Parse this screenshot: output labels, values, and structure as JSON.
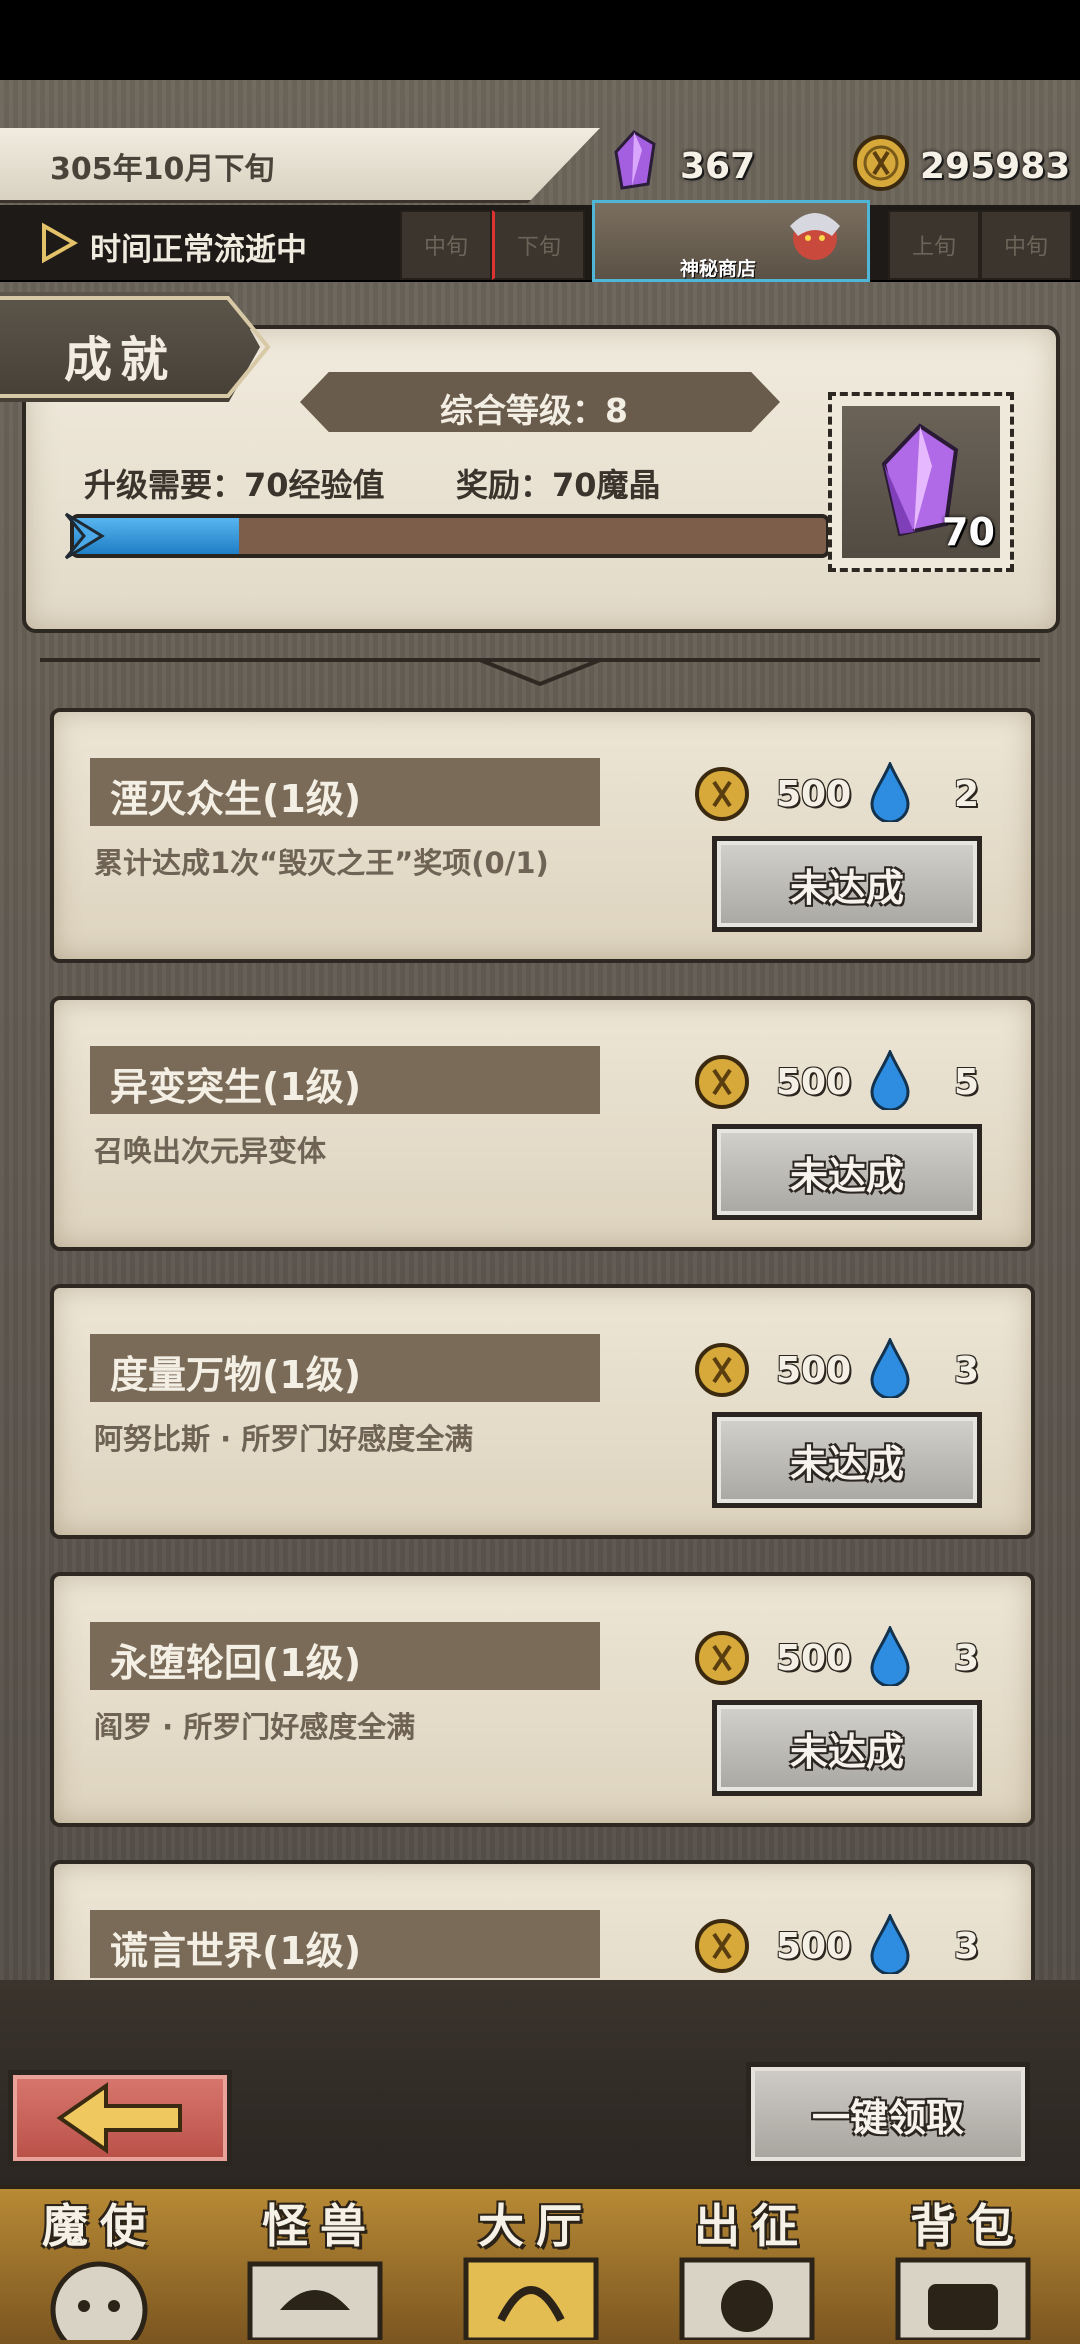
{
  "header": {
    "date": "305年10月下旬",
    "crystal_count": "367",
    "coin_count": "295983",
    "time_status": "时间正常流逝中",
    "slots_left": [
      "中旬",
      "下旬"
    ],
    "shop_label": "神秘商店",
    "slots_right": [
      "上旬",
      "中旬"
    ]
  },
  "achievement": {
    "tab_title": "成就",
    "level_label": "综合等级：8",
    "upgrade_requirement": "升级需要：70经验值",
    "reward_label": "奖励：70魔晶",
    "progress_fraction": 0.22,
    "reward_stamp_count": "70"
  },
  "items": [
    {
      "name": "湮灭众生(1级)",
      "desc": "累计达成1次“毁灭之王”奖项(0/1)",
      "coin": "500",
      "drop": "2",
      "status": "未达成"
    },
    {
      "name": "异变突生(1级)",
      "desc": "召唤出次元异变体",
      "coin": "500",
      "drop": "5",
      "status": "未达成"
    },
    {
      "name": "度量万物(1级)",
      "desc": "阿努比斯 · 所罗门好感度全满",
      "coin": "500",
      "drop": "3",
      "status": "未达成"
    },
    {
      "name": "永堕轮回(1级)",
      "desc": "阎罗 · 所罗门好感度全满",
      "coin": "500",
      "drop": "3",
      "status": "未达成"
    },
    {
      "name": "谎言世界(1级)",
      "desc": "",
      "coin": "500",
      "drop": "3",
      "status": ""
    }
  ],
  "actions": {
    "claim_all": "一键领取"
  },
  "nav": [
    {
      "label": "魔使",
      "icon": "demon-envoy-icon"
    },
    {
      "label": "怪兽",
      "icon": "monster-icon"
    },
    {
      "label": "大厅",
      "icon": "hall-icon"
    },
    {
      "label": "出征",
      "icon": "expedition-icon"
    },
    {
      "label": "背包",
      "icon": "backpack-icon"
    }
  ],
  "colors": {
    "crystal": "#a45ee0",
    "coin": "#d6a93a",
    "drop": "#2e8de0",
    "progress": "#2f8fd6",
    "nav_active": "#d8b24a"
  }
}
